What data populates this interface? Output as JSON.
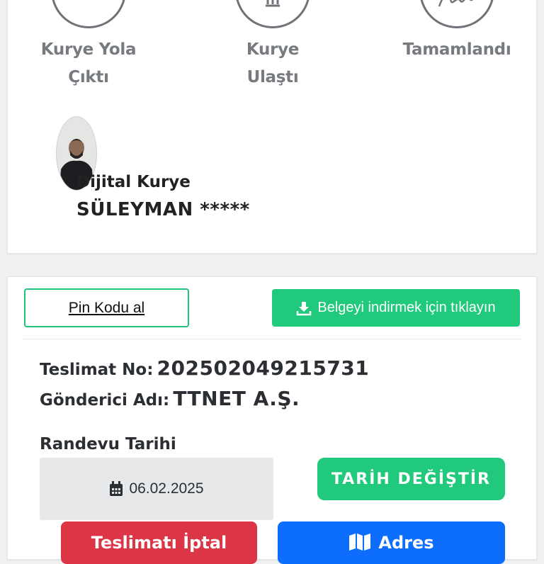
{
  "steps": [
    {
      "label_line1": "Kurye Yola",
      "label_line2": "Çıktı",
      "icon": "scooter-icon"
    },
    {
      "label_line1": "Kurye",
      "label_line2": "Ulaştı",
      "icon": "building-icon"
    },
    {
      "label_line1": "Tamamlandı",
      "label_line2": "",
      "icon": "signature-icon"
    }
  ],
  "courier": {
    "type": "Dijital Kurye",
    "name": "SÜLEYMAN *****"
  },
  "actions": {
    "pin_label": "Pin Kodu al",
    "download_label": "Belgeyi indirmek için tıklayın"
  },
  "delivery": {
    "no_label": "Teslimat No:",
    "no_value": "202502049215731",
    "sender_label": "Gönderici Adı:",
    "sender_value": "TTNET A.Ş.",
    "appointment_label": "Randevu Tarihi",
    "date_value": "06.02.2025",
    "change_date_label": "TARİH DEĞİŞTİR",
    "cancel_label": "Teslimatı İptal",
    "address_label": "Adres"
  },
  "colors": {
    "accent_green": "#20c97b",
    "danger_red": "#dc3545",
    "primary_blue": "#0d6efd"
  }
}
